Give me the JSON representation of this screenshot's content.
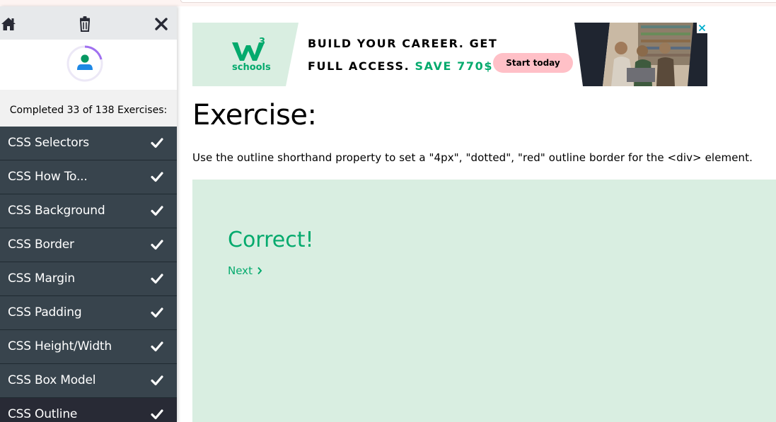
{
  "sidebar": {
    "progress_text": "Completed 33 of 138 Exercises:",
    "progress_fraction": 0.24,
    "items": [
      {
        "label": "CSS Selectors",
        "done": true
      },
      {
        "label": "CSS How To...",
        "done": true
      },
      {
        "label": "CSS Background",
        "done": true
      },
      {
        "label": "CSS Border",
        "done": true
      },
      {
        "label": "CSS Margin",
        "done": true
      },
      {
        "label": "CSS Padding",
        "done": true
      },
      {
        "label": "CSS Height/Width",
        "done": true
      },
      {
        "label": "CSS Box Model",
        "done": true
      },
      {
        "label": "CSS Outline",
        "done": true
      }
    ],
    "icons": [
      "home-icon",
      "trash-icon",
      "close-icon"
    ]
  },
  "ad": {
    "logo_mark": "3",
    "logo_text": "schools",
    "line1": "BUILD YOUR CAREER. GET",
    "line2_prefix": "FULL ACCESS.",
    "line2_highlight": "SAVE 770$",
    "cta": "Start today",
    "close_icon": "ad-close-icon"
  },
  "main": {
    "title": "Exercise:",
    "instruction": "Use the outline shorthand property to set a \"4px\", \"dotted\", \"red\" outline border for the <div> element.",
    "result_title": "Correct!",
    "next_label": "Next"
  },
  "colors": {
    "accent_green": "#04aa6d",
    "result_bg": "#d9eee1",
    "sidebar_item_bg": "#38444d",
    "progress_ring": "#a070f0"
  }
}
